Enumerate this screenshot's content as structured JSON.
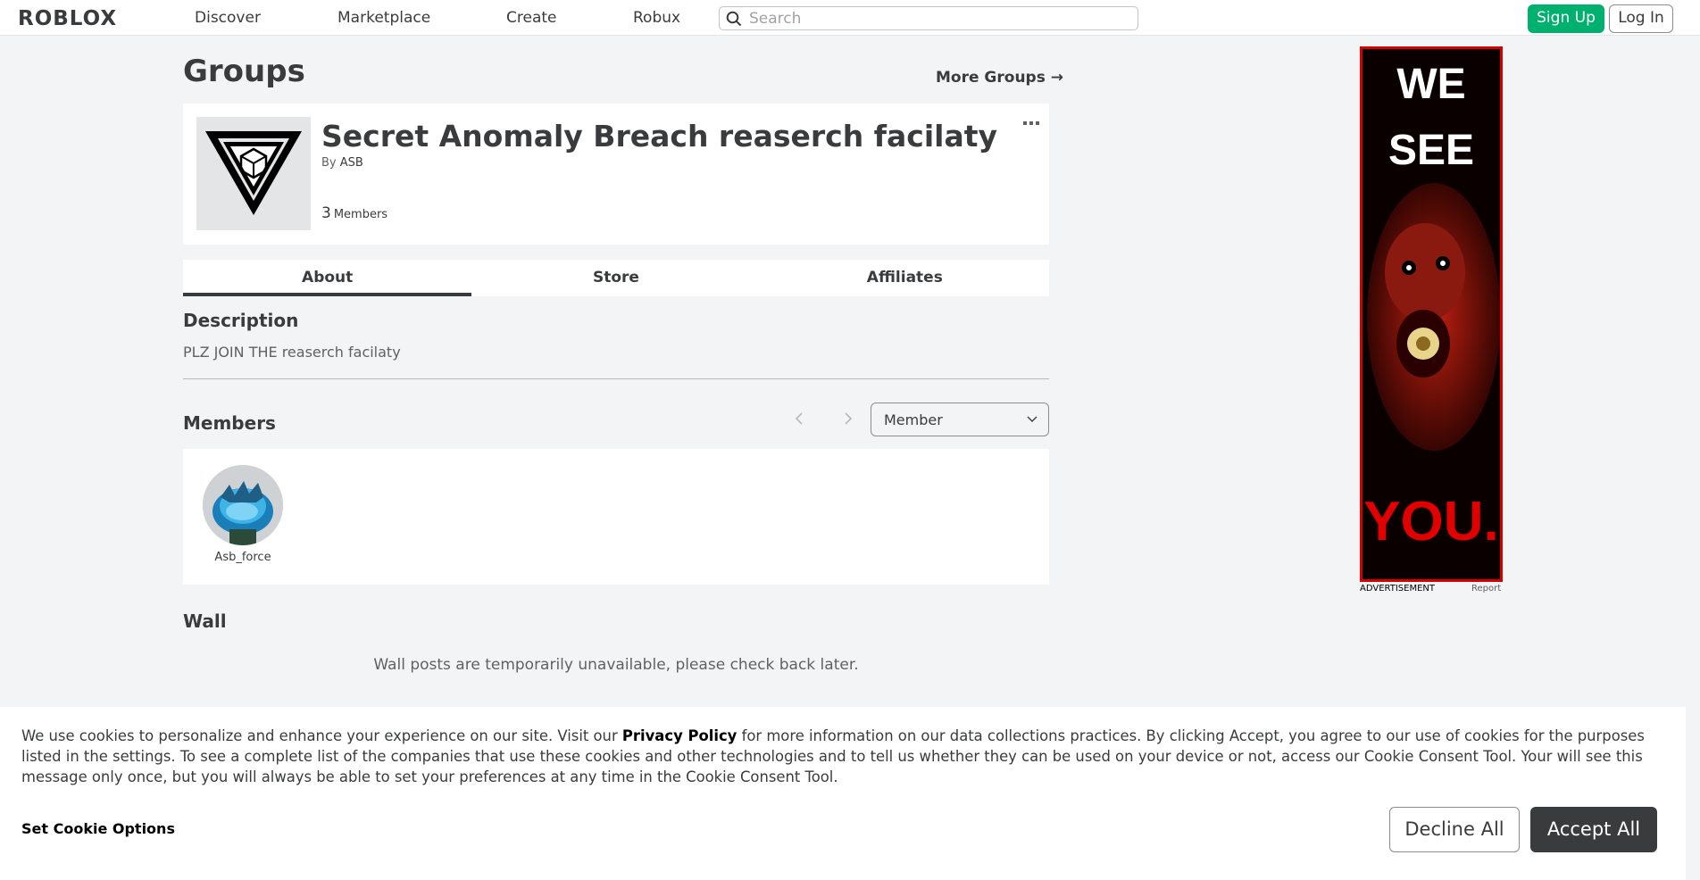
{
  "nav": {
    "logo": "ROBLOX",
    "links": [
      "Discover",
      "Marketplace",
      "Create",
      "Robux"
    ],
    "search_placeholder": "Search",
    "signup_label": "Sign Up",
    "login_label": "Log In"
  },
  "page": {
    "title": "Groups",
    "more_groups": "More Groups →"
  },
  "group": {
    "name": "Secret Anomaly Breach reaserch facilaty",
    "owner_prefix": "By",
    "owner": "ASB",
    "member_count": "3",
    "member_label": "Members"
  },
  "tabs": [
    "About",
    "Store",
    "Affiliates"
  ],
  "about": {
    "description_heading": "Description",
    "description_text": "PLZ JOIN THE reaserch facilaty"
  },
  "members": {
    "heading": "Members",
    "role_selected": "Member",
    "list": [
      {
        "name": "Asb_force"
      }
    ]
  },
  "wall": {
    "heading": "Wall",
    "message": "Wall posts are temporarily unavailable, please check back later."
  },
  "ad": {
    "line1": "WE",
    "line2": "SEE",
    "line3": "YOU.",
    "label": "ADVERTISEMENT",
    "report": "Report"
  },
  "cookie": {
    "text_before": "We use cookies to personalize and enhance your experience on our site. Visit our ",
    "privacy_link": "Privacy Policy",
    "text_after": " for more information on our data collections practices. By clicking Accept, you agree to our use of cookies for the purposes listed in the settings. To see a complete list of the companies that use these cookies and other technologies and to tell us whether they can be used on your device or not, access our Cookie Consent Tool. Your will see this message only once, but you will always be able to set your preferences at any time in the Cookie Consent Tool.",
    "set_options": "Set Cookie Options",
    "decline": "Decline All",
    "accept": "Accept All"
  },
  "colors": {
    "accent_green": "#00b06f",
    "text_dark": "#393b3d",
    "background": "#f2f4f5"
  }
}
